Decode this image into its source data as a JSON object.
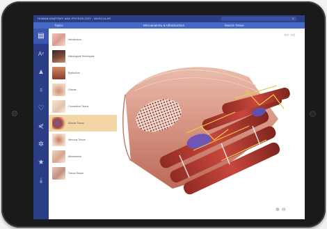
{
  "app": {
    "title": "HUMAN ANATOMY AND PHYSIOLOGY - MUSCULAR",
    "tabs": [
      "Topics",
      "Microanatomy & Ultrastructure",
      "Muscle Tissue"
    ],
    "search_icon": "search-icon"
  },
  "sidebar_icons": [
    "book-icon",
    "a-z-icon",
    "pyramid-icon",
    "lightbulb-icon",
    "heart-icon",
    "share-icon",
    "gear-icon",
    "star-icon",
    "download-icon"
  ],
  "topics": [
    {
      "label": "Introduction",
      "thumb_color": "#d99a8e"
    },
    {
      "label": "Histological Techniques",
      "thumb_color": "#7b4a3a"
    },
    {
      "label": "Epithelium",
      "thumb_color": "#b56a4c"
    },
    {
      "label": "Glands",
      "thumb_color": "#cf8c6e"
    },
    {
      "label": "Connective Tissue",
      "thumb_color": "#e3c4a8"
    },
    {
      "label": "Muscle Tissue",
      "thumb_color": "#a8483b"
    },
    {
      "label": "Nervous Tissue",
      "thumb_color": "#c77a5a"
    },
    {
      "label": "Membranes",
      "thumb_color": "#d7a58e"
    },
    {
      "label": "Tissue Repair",
      "thumb_color": "#c29080"
    }
  ],
  "selected_topic": "Muscle Tissue",
  "viewer": {
    "nav_icons": [
      "arrow-left-icon",
      "arrow-right-icon"
    ],
    "zoom_icons": [
      "zoom-in-icon",
      "zoom-out-icon"
    ]
  },
  "colors": {
    "header": "#2c3f86",
    "tabbar": "#4669c6",
    "rail": "#2a3d85",
    "selected_row": "#f3d6a6"
  }
}
